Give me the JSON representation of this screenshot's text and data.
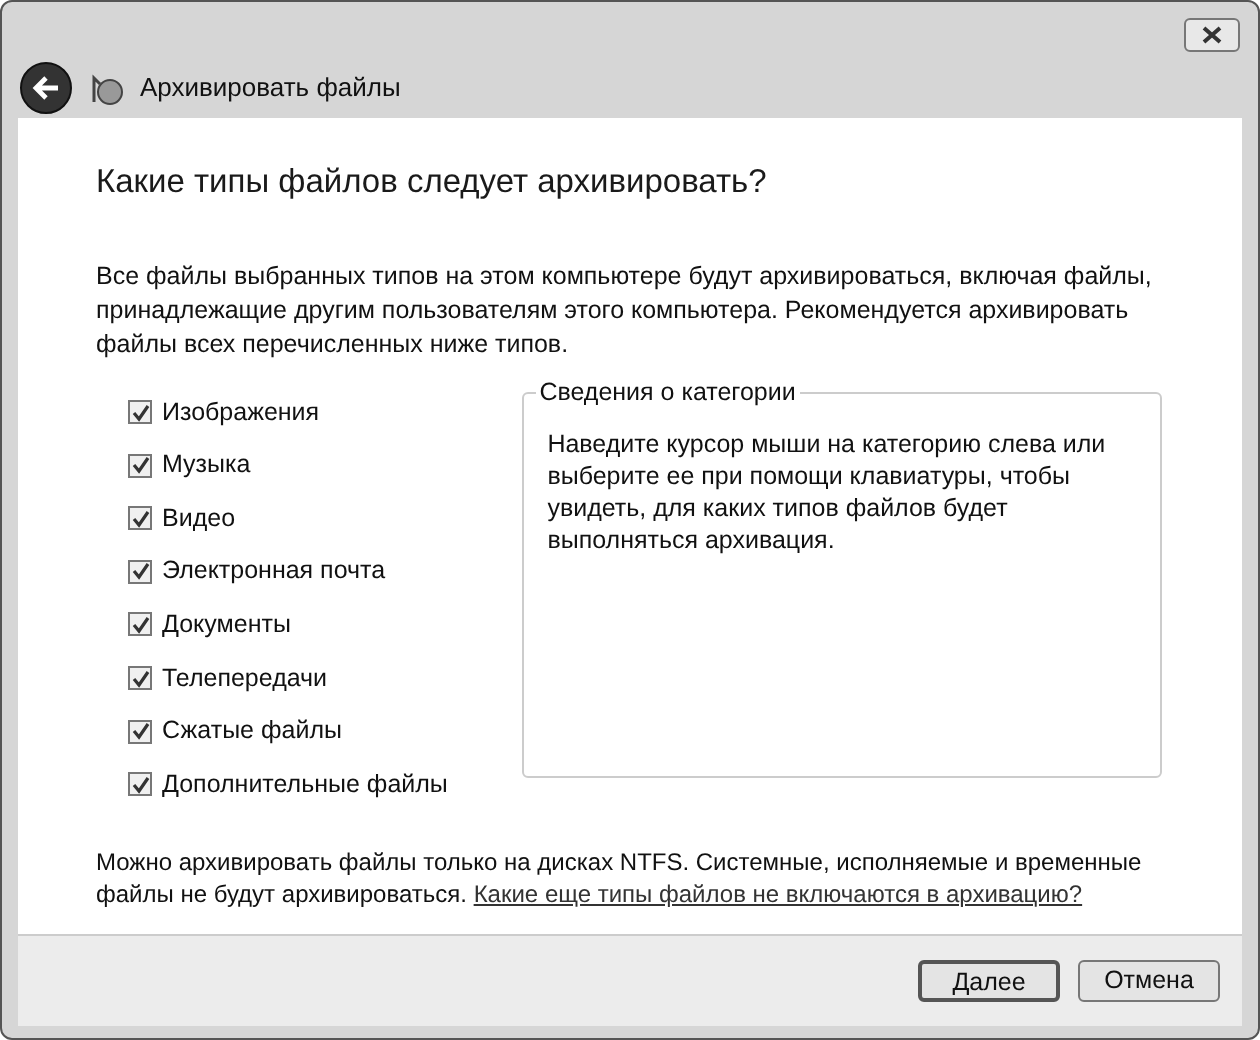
{
  "window": {
    "title": "Архивировать файлы"
  },
  "heading": "Какие типы файлов следует архивировать?",
  "intro": "Все файлы выбранных типов на этом компьютере будут архивироваться, включая файлы, принадлежащие другим пользователям этого компьютера. Рекомендуется архивировать файлы всех перечисленных ниже типов.",
  "categories": [
    {
      "label": "Изображения",
      "checked": true
    },
    {
      "label": "Музыка",
      "checked": true
    },
    {
      "label": "Видео",
      "checked": true
    },
    {
      "label": "Электронная почта",
      "checked": true
    },
    {
      "label": "Документы",
      "checked": true
    },
    {
      "label": "Телепередачи",
      "checked": true
    },
    {
      "label": "Сжатые файлы",
      "checked": true
    },
    {
      "label": "Дополнительные файлы",
      "checked": true
    }
  ],
  "details": {
    "title": "Сведения о категории",
    "text": "Наведите курсор мыши на категорию слева или выберите ее при помощи клавиатуры, чтобы увидеть, для каких типов файлов будет выполняться архивация."
  },
  "note": {
    "text": "Можно архивировать файлы только на дисках NTFS. Системные, исполняемые и временные файлы не будут архивироваться.",
    "link": "Какие еще типы файлов не включаются в архивацию?"
  },
  "buttons": [
    {
      "label": "Далее",
      "default": true
    },
    {
      "label": "Отмена",
      "default": false
    }
  ]
}
